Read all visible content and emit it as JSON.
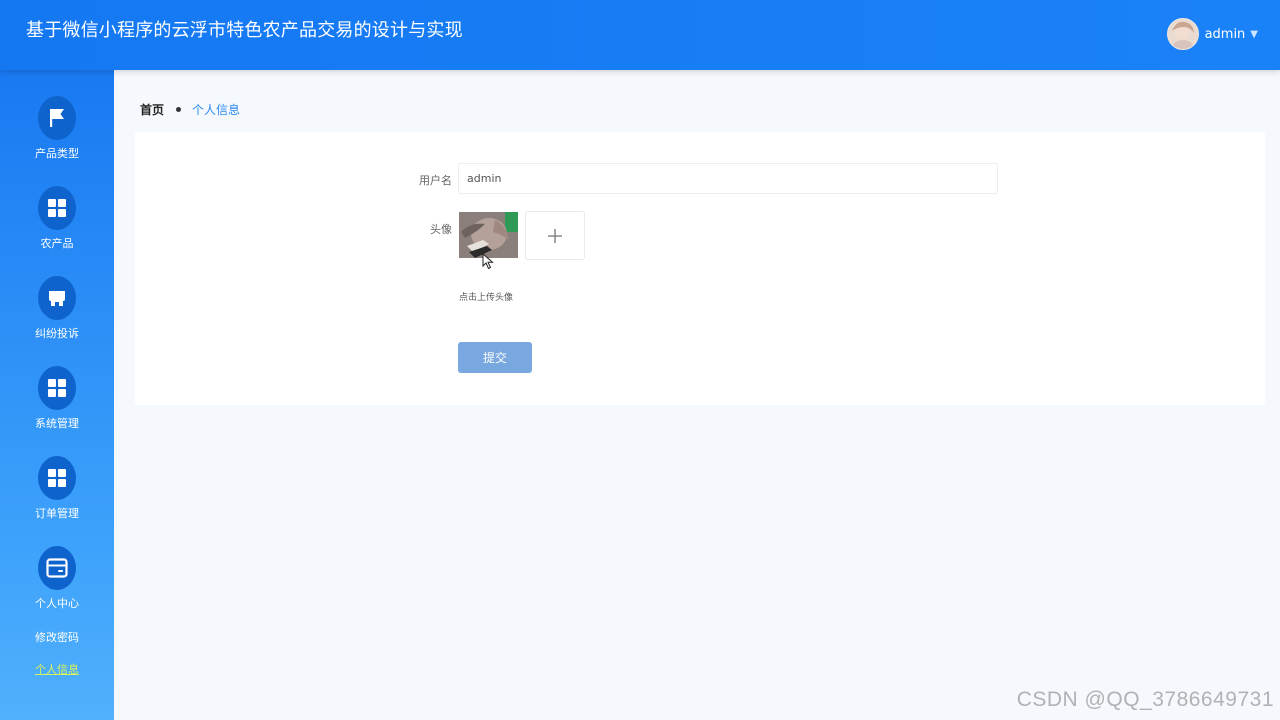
{
  "header": {
    "title": "基于微信小程序的云浮市特色农产品交易的设计与实现",
    "user_name": "admin",
    "caret_icon": "caret-down-icon"
  },
  "sidebar": {
    "items": [
      {
        "label": "产品类型",
        "icon": "flag-icon"
      },
      {
        "label": "农产品",
        "icon": "grid-icon"
      },
      {
        "label": "纠纷投诉",
        "icon": "store-icon"
      },
      {
        "label": "系统管理",
        "icon": "grid-icon"
      },
      {
        "label": "订单管理",
        "icon": "grid-icon"
      },
      {
        "label": "个人中心",
        "icon": "wallet-icon"
      }
    ],
    "subitems": [
      {
        "label": "修改密码",
        "active": false
      },
      {
        "label": "个人信息",
        "active": true
      }
    ]
  },
  "breadcrumb": {
    "home": "首页",
    "current": "个人信息"
  },
  "form": {
    "username_label": "用户名",
    "username_value": "admin",
    "avatar_label": "头像",
    "upload_hint": "点击上传头像",
    "submit_label": "提交",
    "upload_icon": "plus-icon"
  },
  "watermark": "CSDN @QQ_3786649731",
  "colors": {
    "header": "#1478f2",
    "sidebar_top": "#1979f2",
    "sidebar_bottom": "#52b0fc",
    "nav_circle": "#0f63cc",
    "active_sub": "#d7f25b",
    "submit": "#78a8df",
    "breadcrumb_current": "#2e8cf0"
  }
}
